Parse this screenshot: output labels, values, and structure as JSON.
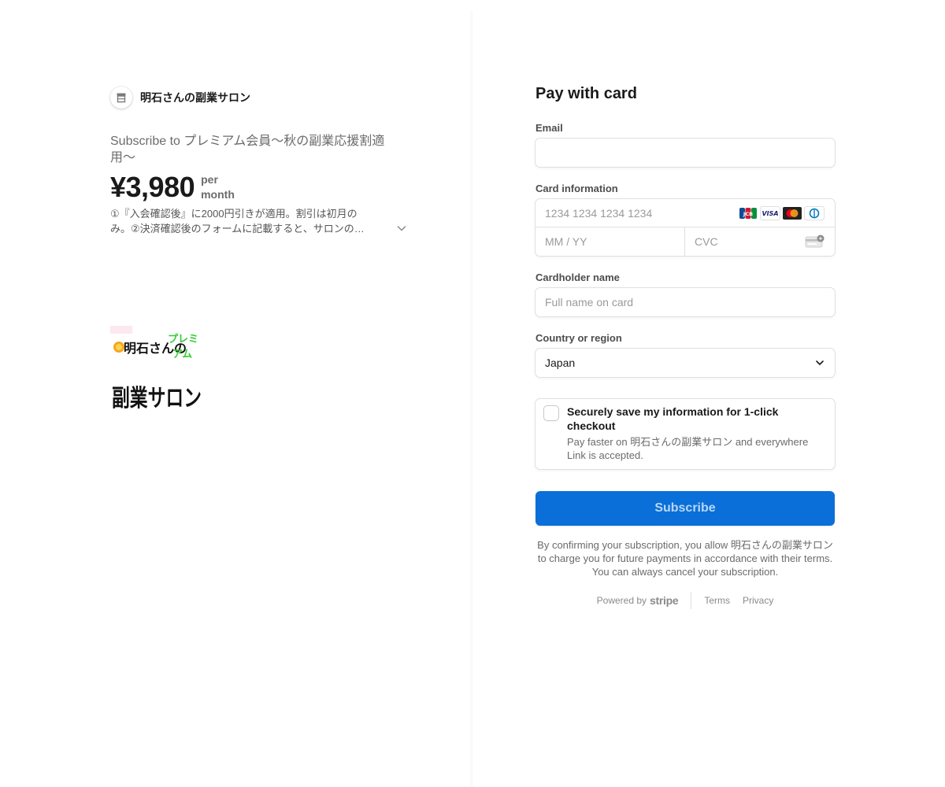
{
  "merchant": {
    "name": "明石さんの副業サロン",
    "icon": "store-icon"
  },
  "product": {
    "title": "Subscribe to プレミアム会員〜秋の副業応援割適用〜",
    "price": "¥3,980",
    "period_line1": "per",
    "period_line2": "month",
    "description_line1": "①『入会確認後』に2000円引きが適用。割引は初月の",
    "description_line2": "み。②決済確認後のフォームに記載すると、サロンの…",
    "image": {
      "line_top": "明石さんの",
      "tag_top": "プレミ",
      "tag_bottom": "アム",
      "line_main": "副業サロン"
    }
  },
  "form": {
    "title": "Pay with card",
    "email": {
      "label": "Email",
      "value": "",
      "placeholder": ""
    },
    "card": {
      "label": "Card information",
      "number_placeholder": "1234 1234 1234 1234",
      "expiry_placeholder": "MM / YY",
      "cvc_placeholder": "CVC",
      "brands": [
        "jcb-icon",
        "visa-icon",
        "mastercard-icon",
        "diners-icon"
      ],
      "brand_visa_text": "VISA",
      "brand_jcb_text": "JCB"
    },
    "cardholder": {
      "label": "Cardholder name",
      "placeholder": "Full name on card"
    },
    "country": {
      "label": "Country or region",
      "value": "Japan"
    },
    "link": {
      "checked": false,
      "title": "Securely save my information for 1-click checkout",
      "subtitle": "Pay faster on 明石さんの副業サロン and everywhere Link is accepted."
    },
    "submit_label": "Subscribe",
    "terms": "By confirming your subscription, you allow 明石さんの副業サロン to charge you for future payments in accordance with their terms. You can always cancel your subscription."
  },
  "footer": {
    "powered_by": "Powered by",
    "brand": "stripe",
    "terms": "Terms",
    "privacy": "Privacy"
  },
  "colors": {
    "accent": "#0a6fd8",
    "text": "#1a1a1a",
    "muted": "#6b6b6b",
    "border": "#e0e0e0"
  }
}
